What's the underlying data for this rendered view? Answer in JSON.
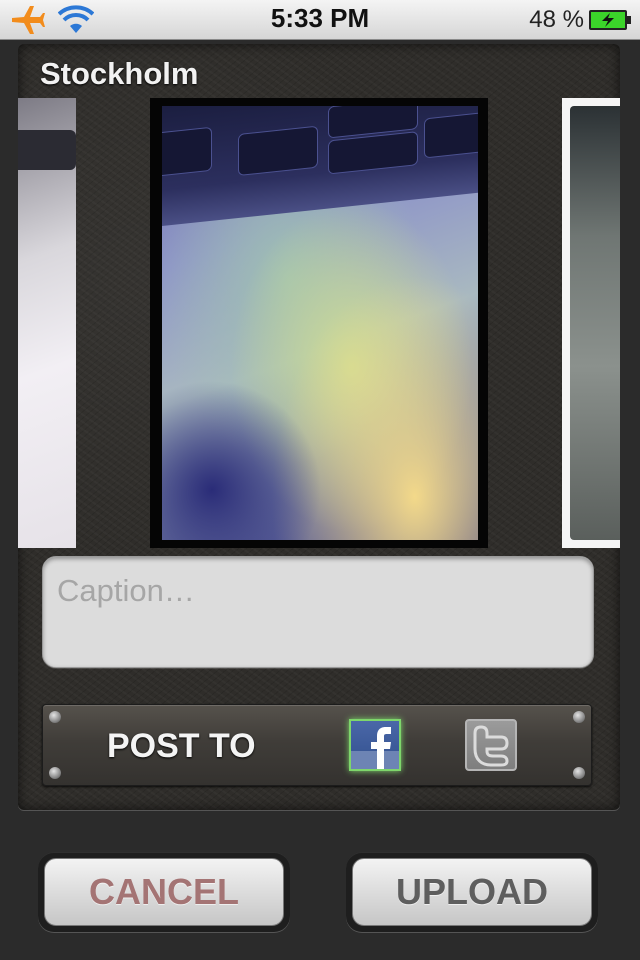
{
  "status_bar": {
    "time": "5:33 PM",
    "battery_percent": "48 %",
    "icons": [
      "airplane-icon",
      "wifi-icon",
      "battery-charging-icon"
    ],
    "colors": {
      "airplane": "#f28c1c",
      "wifi": "#2c78d6",
      "battery": "#3bd42a"
    }
  },
  "location": {
    "title": "Stockholm"
  },
  "carousel": {
    "photos": [
      "photo-previous",
      "photo-current",
      "photo-next"
    ]
  },
  "caption": {
    "placeholder": "Caption…",
    "value": ""
  },
  "post_to": {
    "label": "POST TO",
    "services": [
      {
        "name": "Facebook",
        "icon": "facebook-icon",
        "selected": true,
        "color": "#3b5998"
      },
      {
        "name": "Twitter",
        "icon": "twitter-icon",
        "selected": false,
        "color": "#8a8a8a"
      }
    ]
  },
  "actions": {
    "cancel_label": "CANCEL",
    "upload_label": "UPLOAD"
  }
}
